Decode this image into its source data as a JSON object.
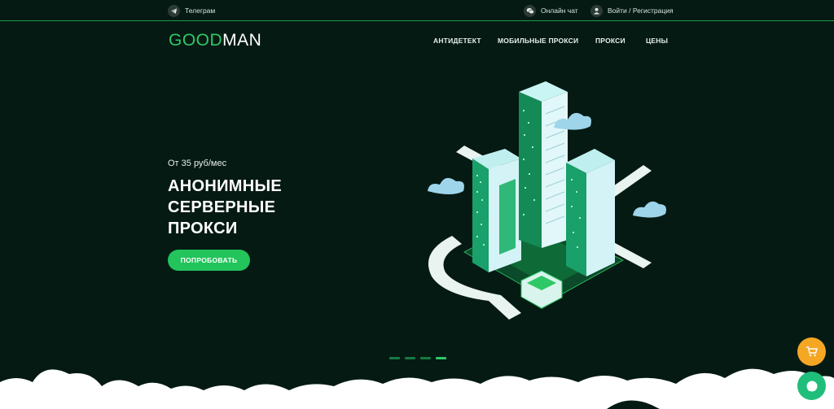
{
  "topbar": {
    "telegram_label": "Телеграм",
    "online_chat_label": "Онлайн чат",
    "login_label": "Войти / Регистрация"
  },
  "logo": {
    "part1": "GOOD",
    "part2": "MAN"
  },
  "nav": {
    "items": [
      {
        "label": "АНТИДЕТЕКТ"
      },
      {
        "label": "МОБИЛЬНЫЕ ПРОКСИ"
      },
      {
        "label": "ПРОКСИ"
      },
      {
        "label": "ЦЕНЫ"
      }
    ]
  },
  "hero": {
    "price": "От 35 руб/мес",
    "title_line1": "АНОНИМНЫЕ",
    "title_line2": "СЕРВЕРНЫЕ",
    "title_line3": "ПРОКСИ",
    "cta_label": "ПОПРОБОВАТЬ"
  },
  "slider": {
    "total": 4,
    "active_index": 3
  },
  "colors": {
    "background": "#061a14",
    "accent_green": "#22c45b",
    "cart_orange": "#f5a623",
    "chat_green": "#1fbe7a"
  },
  "icons": {
    "telegram": "telegram-icon",
    "chat": "chat-bubble-icon",
    "user": "user-icon",
    "cart": "cart-icon",
    "support": "chat-icon"
  }
}
